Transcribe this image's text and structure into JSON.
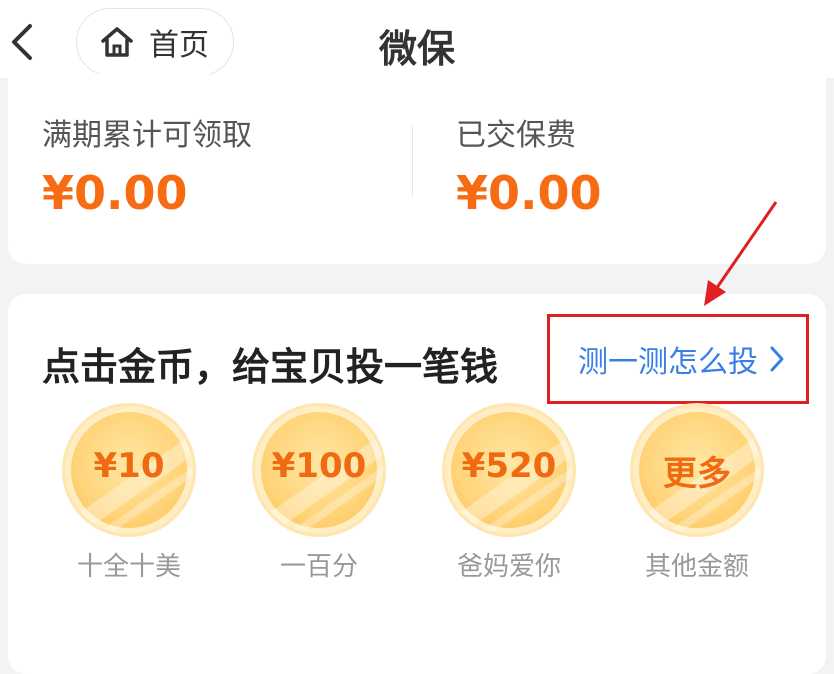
{
  "header": {
    "title": "微保",
    "home_label": "首页",
    "back_icon": "chevron-left-icon",
    "home_icon": "home-icon"
  },
  "summary": {
    "maturity_label": "满期累计可领取",
    "maturity_value": "¥0.00",
    "paid_label": "已交保费",
    "paid_value": "¥0.00"
  },
  "invest": {
    "title": "点击金币，给宝贝投一笔钱",
    "test_link": "测一测怎么投",
    "coins": [
      {
        "amount": "¥10",
        "caption": "十全十美"
      },
      {
        "amount": "¥100",
        "caption": "一百分"
      },
      {
        "amount": "¥520",
        "caption": "爸妈爱你"
      },
      {
        "amount": "更多",
        "caption": "其他金额"
      }
    ]
  },
  "colors": {
    "accent_orange": "#f76b12",
    "link_blue": "#3a7fe6",
    "annotation_red": "#e02020"
  }
}
